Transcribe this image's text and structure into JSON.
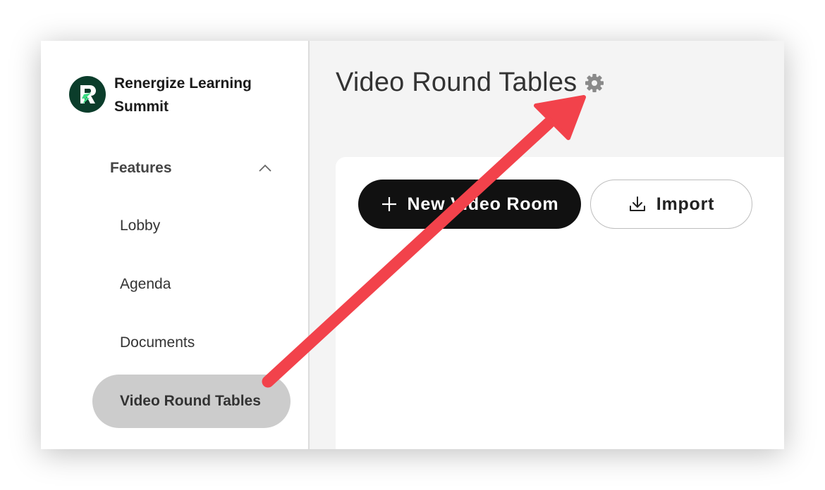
{
  "brand": {
    "name": "Renergize Learning Summit",
    "logo_icon": "renergize-logo-icon",
    "logo_color": "#0b3d2b",
    "logo_accent": "#3ddc84"
  },
  "sidebar": {
    "section": {
      "title": "Features",
      "expanded": true,
      "icon": "chevron-up-icon"
    },
    "items": [
      {
        "label": "Lobby",
        "active": false
      },
      {
        "label": "Agenda",
        "active": false
      },
      {
        "label": "Documents",
        "active": false
      },
      {
        "label": "Video Round Tables",
        "active": true
      }
    ]
  },
  "main": {
    "title": "Video Round Tables",
    "settings_icon": "gear-icon",
    "actions": {
      "new_room_label": "New Video Room",
      "new_room_icon": "plus-icon",
      "import_label": "Import",
      "import_icon": "download-icon"
    }
  },
  "annotation": {
    "icon": "red-arrow-annotation",
    "color": "#f2424b"
  }
}
